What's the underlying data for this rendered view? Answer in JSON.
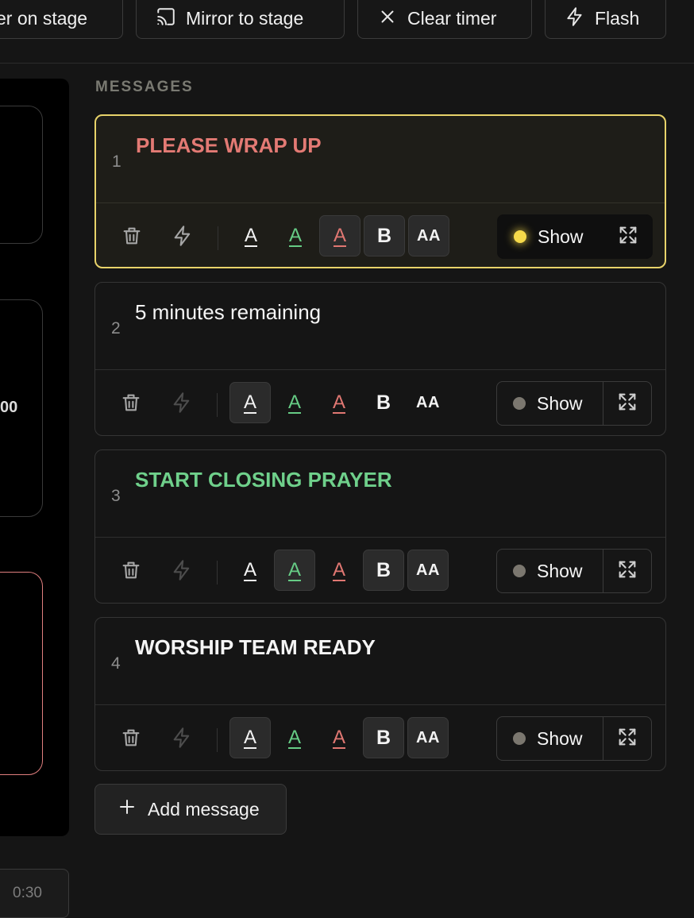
{
  "toolbar": {
    "buttons": [
      {
        "label": "er on stage",
        "icon": "none"
      },
      {
        "label": "Mirror to stage",
        "icon": "cast-icon"
      },
      {
        "label": "Clear timer",
        "icon": "close-icon"
      },
      {
        "label": "Flash",
        "icon": "flash-icon"
      }
    ]
  },
  "left_panel": {
    "partial_value": "00",
    "duration_input": "0:30",
    "accent_border": "#e07f7f"
  },
  "messages_section": {
    "title": "MESSAGES",
    "add_label": "Add message",
    "items": [
      {
        "num": "1",
        "text": "PLEASE WRAP UP",
        "color": "red",
        "bold": true,
        "show_label": "Show",
        "live": true
      },
      {
        "num": "2",
        "text": "5 minutes remaining",
        "color": "white",
        "bold": false,
        "show_label": "Show",
        "live": false
      },
      {
        "num": "3",
        "text": "START CLOSING PRAYER",
        "color": "green",
        "bold": true,
        "show_label": "Show",
        "live": false
      },
      {
        "num": "4",
        "text": "WORSHIP TEAM READY",
        "color": "white",
        "bold": true,
        "show_label": "Show",
        "live": false
      }
    ]
  },
  "format_labels": {
    "a": "A",
    "bold": "B",
    "caps": "AA"
  },
  "colors": {
    "active_border": "#e8d36a",
    "live_dot": "#f5d94a",
    "text_red": "#e37a74",
    "text_green": "#6fd08b"
  }
}
